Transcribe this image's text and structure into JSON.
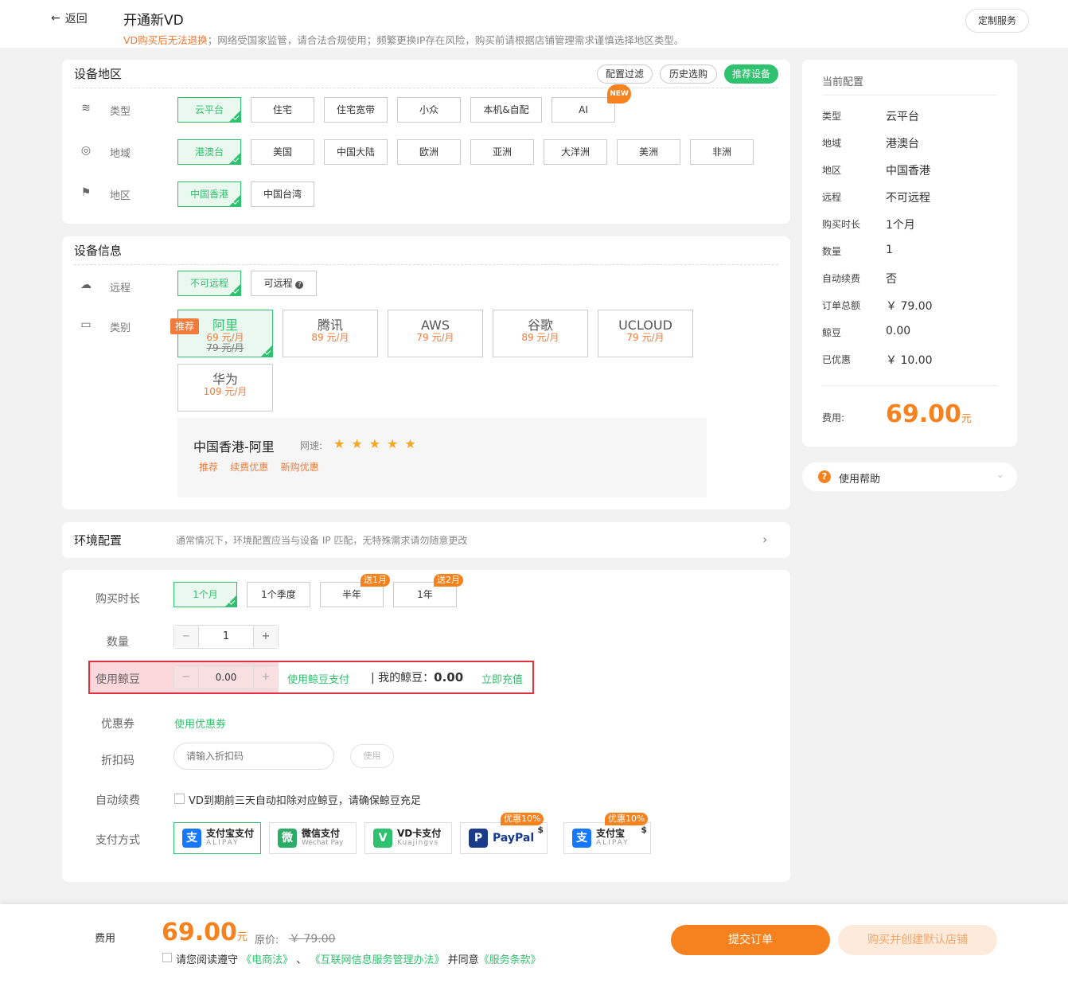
{
  "header": {
    "back_label": "返回",
    "title": "开通新VD",
    "notice_warn": "VD购买后无法退换",
    "notice_rest": "；网络受国家监管，请合法合规使用；频繁更换IP存在风险，购买前请根据店铺管理需求谨慎选择地区类型。",
    "custom_service": "定制服务"
  },
  "region_section": {
    "title": "设备地区",
    "filters": [
      "配置过滤",
      "历史选购",
      "推荐设备"
    ],
    "type_label": "类型",
    "types": [
      "云平台",
      "住宅",
      "住宅宽带",
      "小众",
      "本机&自配",
      "AI"
    ],
    "new_badge": "NEW",
    "area_label": "地域",
    "areas": [
      "港澳台",
      "美国",
      "中国大陆",
      "欧洲",
      "亚洲",
      "大洋洲",
      "美洲",
      "非洲"
    ],
    "region_label": "地区",
    "regions": [
      "中国香港",
      "中国台湾"
    ]
  },
  "device_section": {
    "title": "设备信息",
    "remote_label": "远程",
    "remote_options": [
      "不可远程",
      "可远程"
    ],
    "category_label": "类别",
    "recommend_tag": "推荐",
    "clouds": [
      {
        "name": "阿里",
        "price": "69 元/月",
        "orig": "79 元/月"
      },
      {
        "name": "腾讯",
        "price": "89 元/月"
      },
      {
        "name": "AWS",
        "price": "79 元/月"
      },
      {
        "name": "谷歌",
        "price": "89 元/月"
      },
      {
        "name": "UCLOUD",
        "price": "79 元/月"
      },
      {
        "name": "华为",
        "price": "109 元/月"
      }
    ],
    "info_title": "中国香港-阿里",
    "speed_label": "网速:",
    "speed_stars": 5,
    "info_tags": [
      "推荐",
      "续费优惠",
      "新购优惠"
    ]
  },
  "env_section": {
    "title": "环境配置",
    "desc": "通常情况下，环境配置应当与设备 IP 匹配，无特殊需求请勿随意更改"
  },
  "purchase": {
    "duration_label": "购买时长",
    "durations": [
      "1个月",
      "1个季度",
      "半年",
      "1年"
    ],
    "promo_half": "送1月",
    "promo_year": "送2月",
    "quantity_label": "数量",
    "quantity": "1",
    "bean_label": "使用鲸豆",
    "bean_value": "0.00",
    "bean_use": "使用鲸豆支付",
    "my_bean_label": "我的鲸豆：",
    "my_bean_value": "0.00",
    "recharge": "立即充值",
    "coupon_label": "优惠券",
    "coupon_link": "使用优惠券",
    "discount_label": "折扣码",
    "discount_placeholder": "请输入折扣码",
    "discount_btn": "使用",
    "auto_label": "自动续费",
    "auto_text": "VD到期前三天自动扣除对应鲸豆，请确保鲸豆充足",
    "pay_label": "支付方式",
    "payments": [
      {
        "name": "支付宝支付",
        "sub": "ALIPAY",
        "icon": "支",
        "color": "#1677ff"
      },
      {
        "name": "微信支付",
        "sub": "Wechat Pay",
        "icon": "微",
        "color": "#2aae67"
      },
      {
        "name": "VD卡支付",
        "sub": "Kuajingvs",
        "icon": "V",
        "color": "#2fc26e"
      },
      {
        "name": "PayPal",
        "sub": "",
        "icon": "P",
        "color": "#1a3a8a"
      },
      {
        "name": "支付宝",
        "sub": "ALIPAY",
        "icon": "支",
        "color": "#1677ff"
      }
    ],
    "pay_promo": "优惠10%"
  },
  "side": {
    "title": "当前配置",
    "rows": [
      {
        "k": "类型",
        "v": "云平台"
      },
      {
        "k": "地域",
        "v": "港澳台"
      },
      {
        "k": "地区",
        "v": "中国香港"
      },
      {
        "k": "远程",
        "v": "不可远程"
      },
      {
        "k": "购买时长",
        "v": "1个月"
      },
      {
        "k": "数量",
        "v": "1"
      },
      {
        "k": "自动续费",
        "v": "否"
      },
      {
        "k": "订单总额",
        "v": "￥ 79.00"
      },
      {
        "k": "鲸豆",
        "v": "0.00"
      },
      {
        "k": "已优惠",
        "v": "￥ 10.00"
      }
    ],
    "fee_label": "费用:",
    "fee_value": "69.00",
    "fee_unit": "元",
    "help": "使用帮助"
  },
  "footer": {
    "fee_label": "费用",
    "fee_value": "69.00",
    "fee_unit": "元",
    "orig_label": "原价:",
    "orig_value": "￥ 79.00",
    "agree_prefix": "请您阅读遵守",
    "law1": "《电商法》",
    "sep": "、",
    "law2": "《互联网信息服务管理办法》",
    "agree_mid": "并同意",
    "law3": "《服务条款》",
    "submit": "提交订单",
    "buy_create": "购买并创建默认店铺"
  }
}
